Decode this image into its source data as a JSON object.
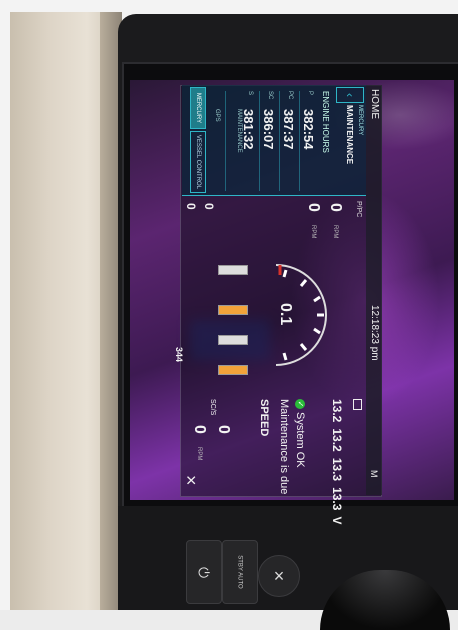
{
  "screen": {
    "header": {
      "title": "HOME",
      "time": "12:18:23 pm",
      "signal": "M"
    },
    "sidebar": {
      "breadcrumb": "MERCURY",
      "section": "MAINTENANCE",
      "group_label": "ENGINE HOURS",
      "rows": [
        {
          "tag": "P",
          "value": "382:54"
        },
        {
          "tag": "PC",
          "value": "387:37"
        },
        {
          "tag": "SC",
          "value": "386:07"
        },
        {
          "tag": "S",
          "value": "381:32",
          "sub": "MAINTENANCE"
        }
      ],
      "footer_sub": "GPS",
      "tabs": [
        {
          "label": "MERCURY"
        },
        {
          "label": "VESSEL CONTROL"
        }
      ]
    },
    "left_engines": {
      "label": "P/PC",
      "rpm_top": "0",
      "rpm_bottom": "0",
      "unit": "RPM"
    },
    "gauge": {
      "value": "0.1",
      "fuel": "344"
    },
    "status": {
      "battery": "",
      "volts": [
        "13.2",
        "13.2",
        "13.3",
        "13.3"
      ],
      "volts_unit": "V",
      "system": "System OK",
      "maintenance": "Maintenance is due",
      "speed": "SPEED",
      "right_label": "SC/S",
      "rpm_top": "0",
      "rpm_bottom": "0",
      "unit": "RPM",
      "close": "×"
    },
    "extra_left": {
      "a": "0",
      "b": "0"
    }
  },
  "hardware": {
    "buttons": [
      {
        "label": "⏻"
      },
      {
        "label": "STBY AUTO"
      },
      {
        "label": "×"
      }
    ]
  },
  "colors": {
    "accent": "#2fb6c7",
    "ok": "#2bbb3a",
    "trim": "#f2a33a"
  }
}
